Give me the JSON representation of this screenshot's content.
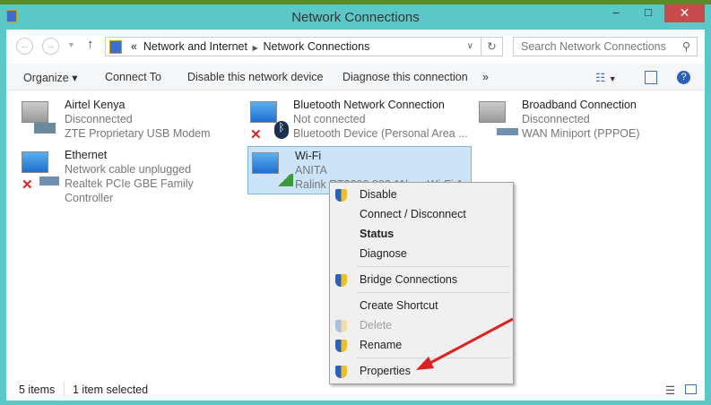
{
  "window": {
    "title": "Network Connections"
  },
  "address": {
    "prefix": "«",
    "crumbs": [
      "Network and Internet",
      "Network Connections"
    ],
    "search_placeholder": "Search Network Connections"
  },
  "toolbar": {
    "organize": "Organize ▾",
    "connect_to": "Connect To",
    "disable": "Disable this network device",
    "diagnose": "Diagnose this connection",
    "more": "»"
  },
  "items": [
    {
      "name": "Airtel Kenya",
      "status": "Disconnected",
      "device": "ZTE Proprietary USB Modem"
    },
    {
      "name": "Bluetooth Network Connection",
      "status": "Not connected",
      "device": "Bluetooth Device (Personal Area ..."
    },
    {
      "name": "Broadband Connection",
      "status": "Disconnected",
      "device": "WAN Miniport (PPPOE)"
    },
    {
      "name": "Ethernet",
      "status": "Network cable unplugged",
      "device": "Realtek PCIe GBE Family Controller"
    },
    {
      "name": "Wi-Fi",
      "status": "ANITA",
      "device": "Ralink RT3290 802.11bgn Wi-Fi A..."
    }
  ],
  "menu": [
    "Disable",
    "Connect / Disconnect",
    "Status",
    "Diagnose",
    "Bridge Connections",
    "Create Shortcut",
    "Delete",
    "Rename",
    "Properties"
  ],
  "statusbar": {
    "count": "5 items",
    "selected": "1 item selected"
  },
  "colors": {
    "frame": "#5bc8c8",
    "close": "#c94a4a",
    "arrow": "#e02020",
    "selection": "#cce4f7"
  }
}
